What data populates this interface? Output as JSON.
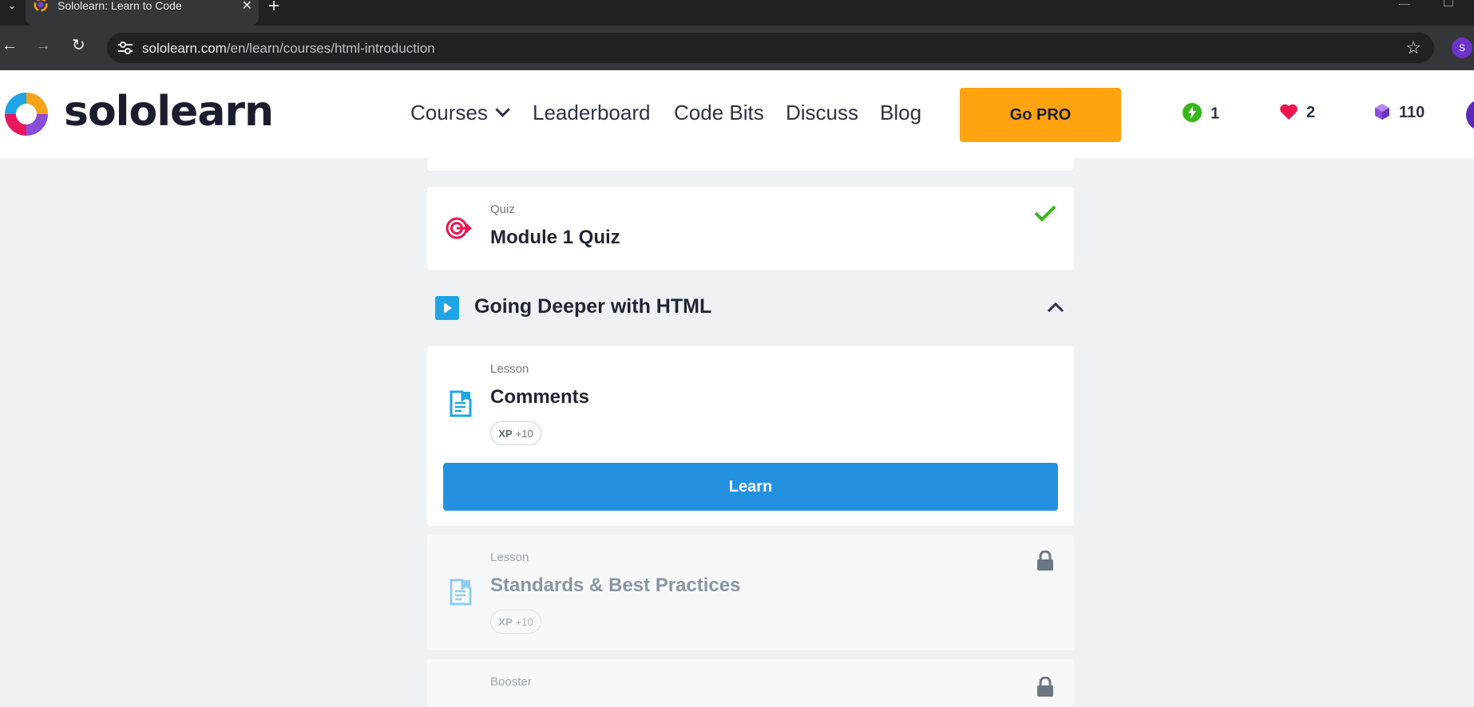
{
  "browser": {
    "tab_title": "Sololearn: Learn to Code",
    "url_host": "sololearn.com",
    "url_path": "/en/learn/courses/html-introduction",
    "profile_initial": "S"
  },
  "header": {
    "logo_text": "sololearn",
    "nav": {
      "courses": "Courses",
      "leaderboard": "Leaderboard",
      "code_bits": "Code Bits",
      "discuss": "Discuss",
      "blog": "Blog"
    },
    "go_pro": "Go PRO",
    "streak": "1",
    "hearts": "2",
    "bits": "110"
  },
  "content": {
    "quiz": {
      "label": "Quiz",
      "title": "Module 1 Quiz",
      "completed": true
    },
    "section": {
      "title": "Going Deeper with HTML",
      "expanded": true
    },
    "lesson1": {
      "label": "Lesson",
      "title": "Comments",
      "xp_label": "XP",
      "xp_value": "+10",
      "button": "Learn"
    },
    "lesson2": {
      "label": "Lesson",
      "title": "Standards & Best Practices",
      "xp_label": "XP",
      "xp_value": "+10",
      "locked": true
    },
    "booster": {
      "label": "Booster",
      "locked": true
    }
  },
  "colors": {
    "accent_blue": "#2491e0",
    "go_pro": "#ffa310",
    "quiz_icon": "#e8174f",
    "check": "#35b71a"
  }
}
